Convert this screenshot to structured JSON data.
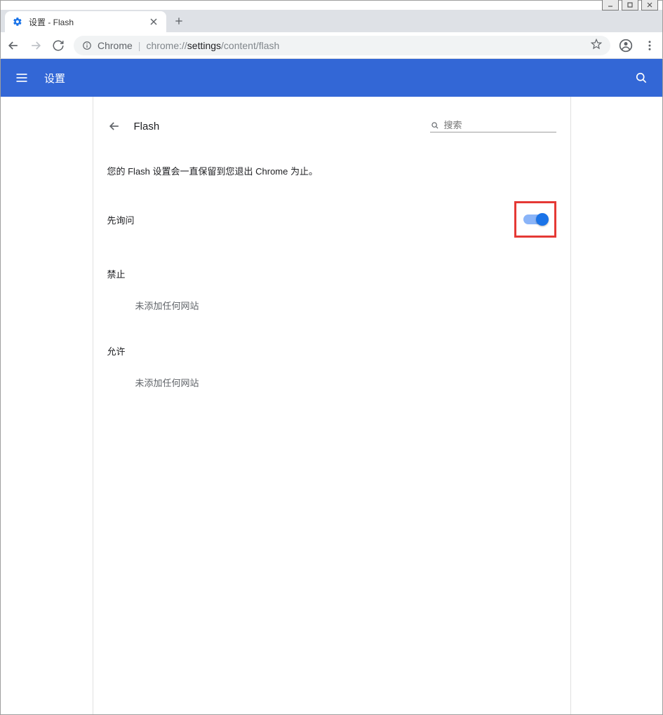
{
  "window": {
    "tab_title": "设置 - Flash"
  },
  "toolbar": {
    "chrome_chip": "Chrome",
    "url_prefix": "chrome://",
    "url_strong": "settings",
    "url_rest": "/content/flash"
  },
  "settings_header": {
    "title": "设置"
  },
  "panel": {
    "title": "Flash",
    "search_placeholder": "搜索",
    "notice": "您的 Flash 设置会一直保留到您退出 Chrome 为止。",
    "ask_first_label": "先询问",
    "block_heading": "禁止",
    "block_empty": "未添加任何网站",
    "allow_heading": "允许",
    "allow_empty": "未添加任何网站"
  },
  "toggle": {
    "ask_first_on": true
  }
}
